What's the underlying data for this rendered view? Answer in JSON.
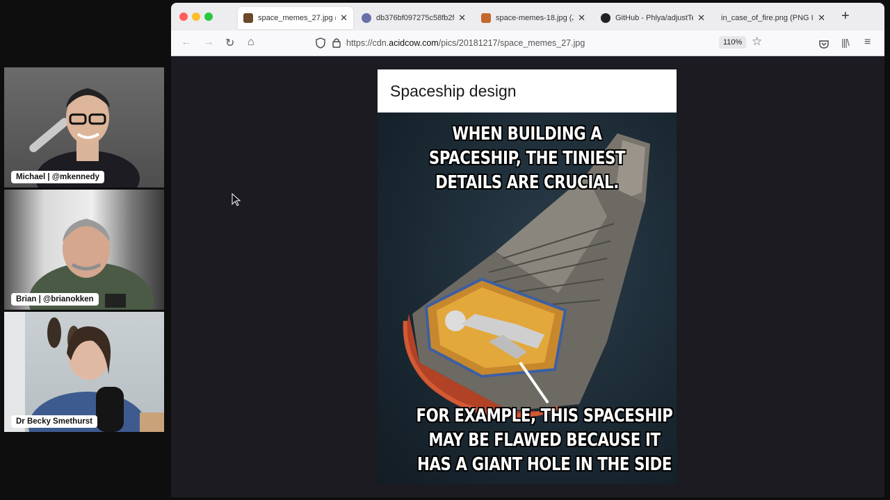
{
  "participants": [
    {
      "name": "Michael | @mkennedy"
    },
    {
      "name": "Brian | @brianokken"
    },
    {
      "name": "Dr Becky Smethurst"
    }
  ],
  "browser": {
    "tabs": [
      {
        "title": "space_memes_27.jpg (JPE",
        "active": true,
        "icon": "image-favicon"
      },
      {
        "title": "db376bf097275c58fb2f6",
        "active": false,
        "icon": "planet-favicon"
      },
      {
        "title": "space-memes-18.jpg (JPE",
        "active": false,
        "icon": "hourglass-favicon"
      },
      {
        "title": "GitHub - Phlya/adjustText",
        "active": false,
        "icon": "github-icon"
      },
      {
        "title": "in_case_of_fire.png (PNG Ima",
        "active": false,
        "icon": "none"
      }
    ],
    "url_prefix": "https://cdn.",
    "url_domain": "acidcow.com",
    "url_path": "/pics/20181217/space_memes_27.jpg",
    "zoom": "110%"
  },
  "meme": {
    "title": "Spaceship design",
    "top_text": [
      "WHEN BUILDING A",
      "SPACESHIP, THE TINIEST",
      "DETAILS ARE CRUCIAL."
    ],
    "bottom_text": [
      "FOR EXAMPLE, THIS SPACESHIP",
      "MAY BE FLAWED BECAUSE IT",
      "HAS A GIANT HOLE IN THE SIDE"
    ]
  }
}
